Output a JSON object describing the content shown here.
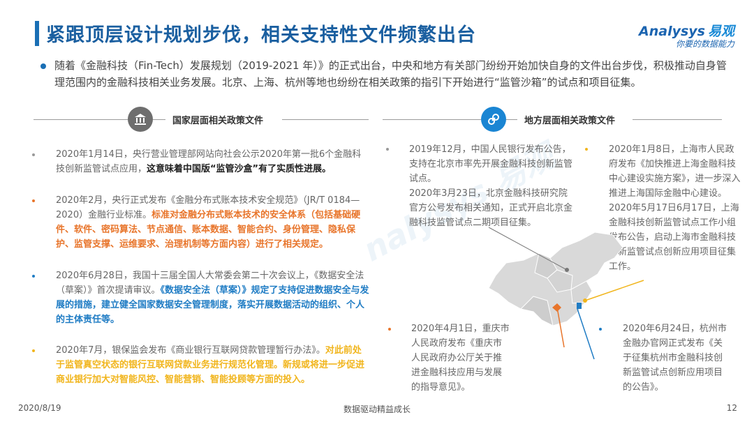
{
  "title": "紧跟顶层设计规划步伐，相关支持性文件频繁出台",
  "logo": {
    "main": "nalysys",
    "main_cn": "易观",
    "sub": "你要的数据能力",
    "mark": "A"
  },
  "intro": "随着《金融科技（Fin-Tech）发展规划（2019-2021 年）》的正式出台，中央和地方有关部门纷纷开始加快自身的文件出台步伐，积极推动自身管理范围内的金融科技相关业务发展。北京、上海、杭州等地也纷纷在相关政策的指引下开始进行“监管沙箱”的试点和项目征集。",
  "sections": {
    "national": "国家层面相关政策文件",
    "local": "地方层面相关政策文件"
  },
  "national_items": [
    {
      "plain": "2020年1月14日，央行营业管理部网站向社会公示2020年第一批6个金融科技创新监管试点应用，",
      "highlight": "这意味着中国版“监管沙盒”有了实质性进展。",
      "style": "black",
      "bullet_color": "#999999"
    },
    {
      "plain": "2020年2月，央行正式发布《金融分布式账本技术安全规范》（JR/T 0184—2020）金融行业标准。",
      "highlight": "标准对金融分布式账本技术的安全体系（包括基础硬件、软件、密码算法、节点通信、账本数据、智能合约、身份管理、隐私保护、监管支撑、运维要求、治理机制等方面内容）进行了相关规定。",
      "style": "orange",
      "bullet_color": "#e8752b"
    },
    {
      "plain": "2020年6月28日，我国十三届全国人大常委会第二十次会议上，《数据安全法（草案）》首次提请审议。",
      "highlight": "《数据安全法（草案）》规定了支持促进数据安全与发展的措施，建立健全国家数据安全管理制度，落实开展数据活动的组织、个人的主体责任等。",
      "style": "blue",
      "bullet_color": "#1f7cc4"
    },
    {
      "plain": "2020年7月，银保监会发布《商业银行互联网贷款管理暂行办法》。",
      "highlight": "对此前处于监管真空状态的银行互联网贷款业务进行规范化管理。新规或将进一步促进商业银行加大对智能风控、智能营销、智能投顾等方面的投入。",
      "style": "yellow",
      "bullet_color": "#f1b51c"
    }
  ],
  "local_items": {
    "beijing": "2019年12月，中国人民银行发布公告，支持在北京市率先开展金融科技创新监管试点。\n2020年3月23日，北京金融科技研究院官方公号发布相关通知，正式开启北京金融科技监管试点二期项目征集。",
    "shanghai": "2020年1月8日，上海市人民政府发布《加快推进上海金融科技中心建设实施方案》，进一步深入推进上海国际金融中心建设。\n2020年5月17日6月17日，上海金融科技创新监管试点工作小组发布公告，启动上海市金融科技创新监管试点创新应用项目征集工作。",
    "chongqing": "2020年4月1日，重庆市人民政府发布《重庆市人民政府办公厅关于推进金融科技应用与发展的指导意见》。",
    "hangzhou": "2020年6月24日，杭州市金融办官网正式发布《关于征集杭州市金融科技创新监管试点创新应用项目的公告》。"
  },
  "colors": {
    "title": "#1a5fa0",
    "accent": "#1a6fb5",
    "orange": "#e8752b",
    "blue": "#1f7cc4",
    "yellow": "#f1b51c",
    "grey": "#999999"
  },
  "footer": {
    "date": "2020/8/19",
    "center": "数据驱动精益成长",
    "page": "12"
  }
}
